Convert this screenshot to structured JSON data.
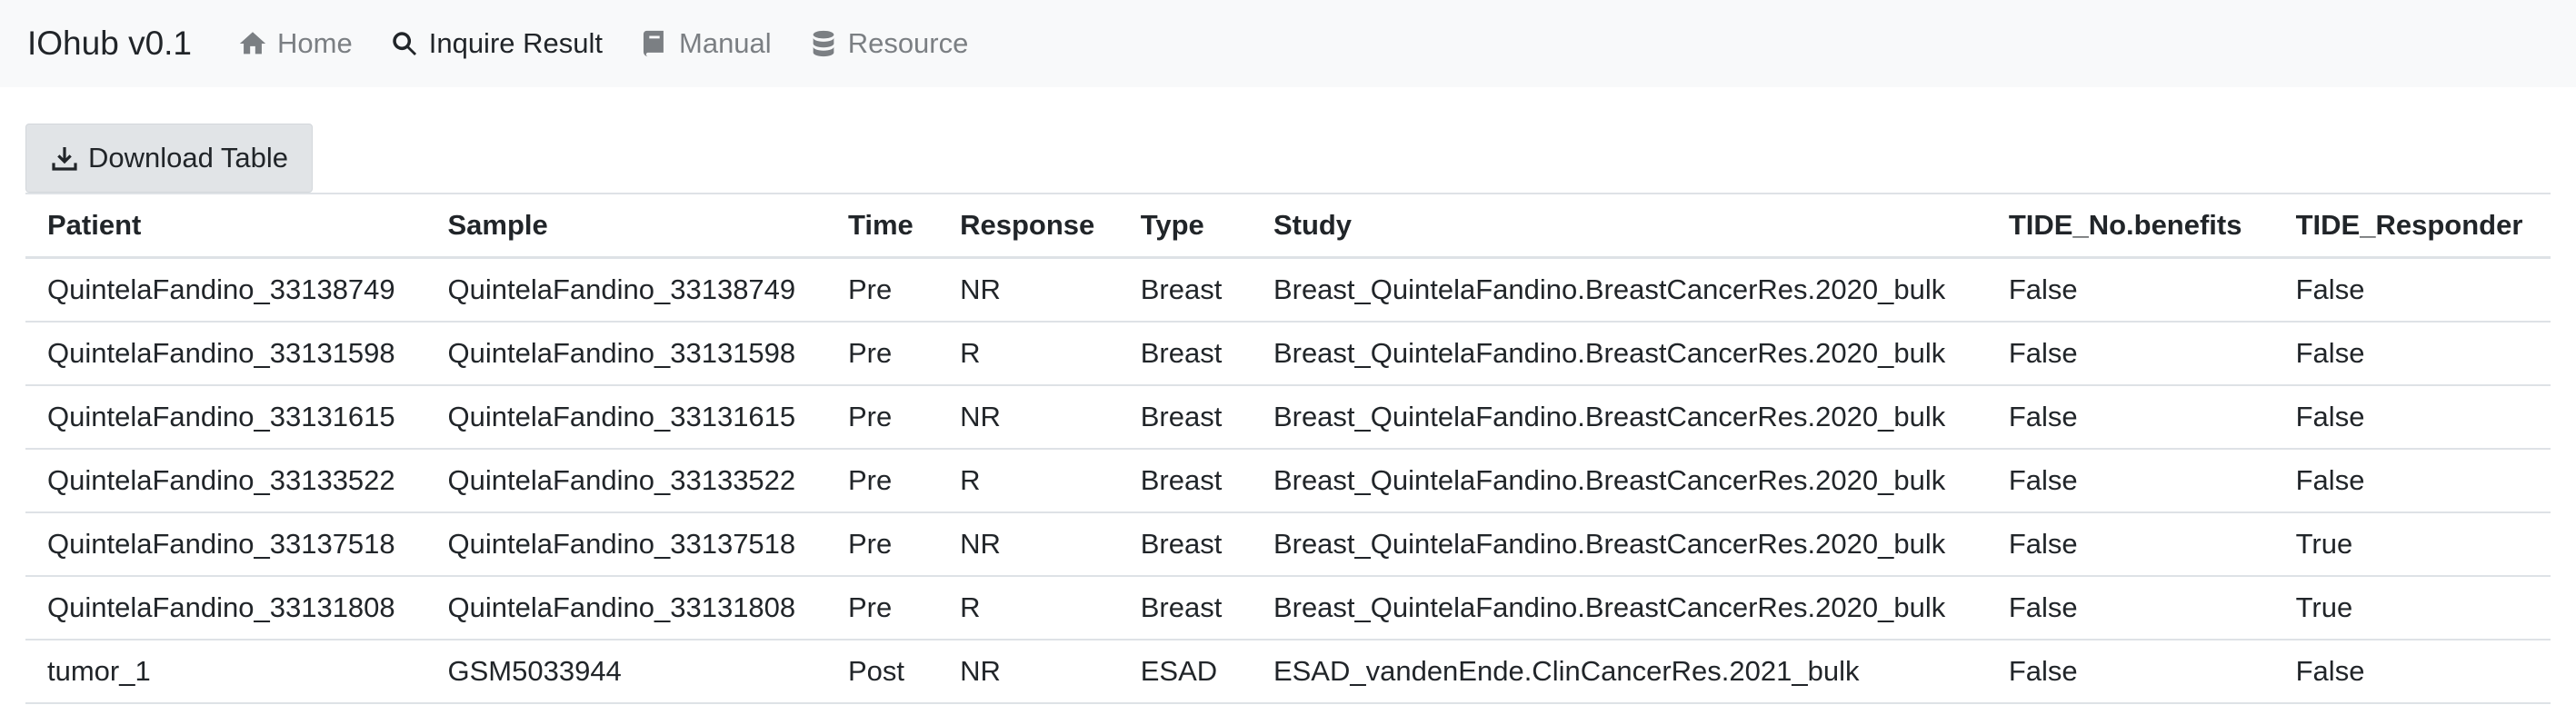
{
  "navbar": {
    "brand": "IOhub v0.1",
    "items": [
      {
        "label": "Home",
        "icon": "home-icon"
      },
      {
        "label": "Inquire Result",
        "icon": "search-icon"
      },
      {
        "label": "Manual",
        "icon": "book-icon"
      },
      {
        "label": "Resource",
        "icon": "database-icon"
      }
    ]
  },
  "toolbar": {
    "download_label": "Download Table",
    "download_icon": "download-icon"
  },
  "table": {
    "columns": [
      "Patient",
      "Sample",
      "Time",
      "Response",
      "Type",
      "Study",
      "TIDE_No.benefits",
      "TIDE_Responder"
    ],
    "rows": [
      [
        "QuintelaFandino_33138749",
        "QuintelaFandino_33138749",
        "Pre",
        "NR",
        "Breast",
        "Breast_QuintelaFandino.BreastCancerRes.2020_bulk",
        "False",
        "False"
      ],
      [
        "QuintelaFandino_33131598",
        "QuintelaFandino_33131598",
        "Pre",
        "R",
        "Breast",
        "Breast_QuintelaFandino.BreastCancerRes.2020_bulk",
        "False",
        "False"
      ],
      [
        "QuintelaFandino_33131615",
        "QuintelaFandino_33131615",
        "Pre",
        "NR",
        "Breast",
        "Breast_QuintelaFandino.BreastCancerRes.2020_bulk",
        "False",
        "False"
      ],
      [
        "QuintelaFandino_33133522",
        "QuintelaFandino_33133522",
        "Pre",
        "R",
        "Breast",
        "Breast_QuintelaFandino.BreastCancerRes.2020_bulk",
        "False",
        "False"
      ],
      [
        "QuintelaFandino_33137518",
        "QuintelaFandino_33137518",
        "Pre",
        "NR",
        "Breast",
        "Breast_QuintelaFandino.BreastCancerRes.2020_bulk",
        "False",
        "True"
      ],
      [
        "QuintelaFandino_33131808",
        "QuintelaFandino_33131808",
        "Pre",
        "R",
        "Breast",
        "Breast_QuintelaFandino.BreastCancerRes.2020_bulk",
        "False",
        "True"
      ],
      [
        "tumor_1",
        "GSM5033944",
        "Post",
        "NR",
        "ESAD",
        "ESAD_vandenEnde.ClinCancerRes.2021_bulk",
        "False",
        "False"
      ]
    ]
  }
}
